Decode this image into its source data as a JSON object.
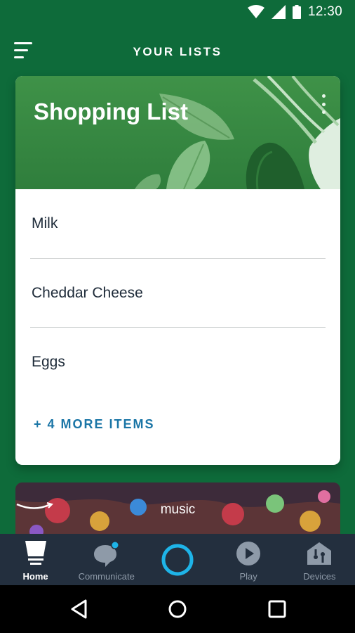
{
  "status_bar": {
    "time": "12:30",
    "icons": [
      "wifi-icon",
      "cell-signal-icon",
      "battery-icon"
    ]
  },
  "app_bar": {
    "title": "YOUR LISTS",
    "menu_icon": "hamburger-menu-icon"
  },
  "shopping_card": {
    "title": "Shopping List",
    "options_icon": "more-vert-icon",
    "items": [
      {
        "label": "Milk"
      },
      {
        "label": "Cheddar Cheese"
      },
      {
        "label": "Eggs"
      }
    ],
    "more_items": "+ 4 MORE ITEMS"
  },
  "music_card": {
    "logo_text": "music"
  },
  "bottom_nav": [
    {
      "label": "Home",
      "icon": "home-icon",
      "active": true
    },
    {
      "label": "Communicate",
      "icon": "chat-bubble-icon",
      "active": false
    },
    {
      "label": "",
      "icon": "alexa-ring-icon",
      "active": false
    },
    {
      "label": "Play",
      "icon": "play-icon",
      "active": false
    },
    {
      "label": "Devices",
      "icon": "devices-home-icon",
      "active": false
    }
  ],
  "system_nav": [
    "back-icon",
    "home-circle-icon",
    "recents-icon"
  ],
  "colors": {
    "background": "#0e6b3a",
    "card_header": "#3f9248",
    "accent_link": "#1a75a6",
    "alexa_blue": "#1eb4e8",
    "nav_background": "#232f3e"
  }
}
